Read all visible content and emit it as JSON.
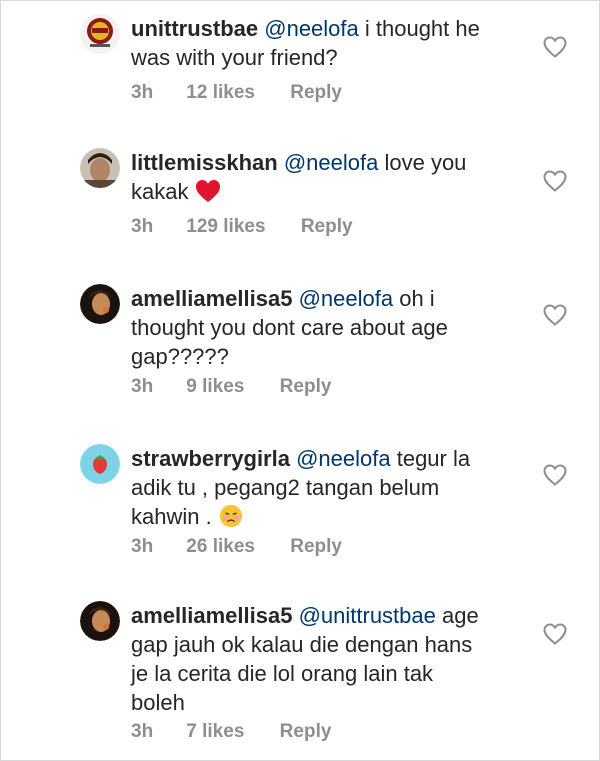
{
  "comments": [
    {
      "username": "unittrustbae",
      "mention": "@neelofa",
      "text_line1": " i thought he",
      "text_line2": "was with your friend?",
      "time": "3h",
      "likes": "12 likes",
      "reply": "Reply"
    },
    {
      "username": "littlemisskhan",
      "mention": "@neelofa",
      "text_line1": " love you",
      "text_line2": "kakak ",
      "emoji": "red-heart-emoji",
      "time": "3h",
      "likes": "129 likes",
      "reply": "Reply"
    },
    {
      "username": "amelliamellisa5",
      "mention": "@neelofa",
      "text_line1": " oh i",
      "text_line2": "thought you dont care about age",
      "text_line3": "gap?????",
      "time": "3h",
      "likes": "9 likes",
      "reply": "Reply"
    },
    {
      "username": "strawberrygirla",
      "mention": "@neelofa",
      "text_line1": " tegur la",
      "text_line2": "adik tu , pegang2 tangan belum",
      "text_line3": "kahwin . ",
      "emoji": "persevering-face-emoji",
      "time": "3h",
      "likes": "26 likes",
      "reply": "Reply"
    },
    {
      "username": "amelliamellisa5",
      "mention": "@unittrustbae",
      "text_line1": " age",
      "text_line2": "gap jauh ok kalau die dengan hans",
      "text_line3": "je la cerita die lol orang lain tak",
      "text_line4": "boleh",
      "time": "3h",
      "likes": "7 likes",
      "reply": "Reply"
    }
  ],
  "colors": {
    "text": "#262626",
    "mention": "#00376b",
    "meta": "#8e8e8e",
    "heart_outline": "#8e8e8e"
  },
  "icons": {
    "like": "heart-outline-icon"
  }
}
